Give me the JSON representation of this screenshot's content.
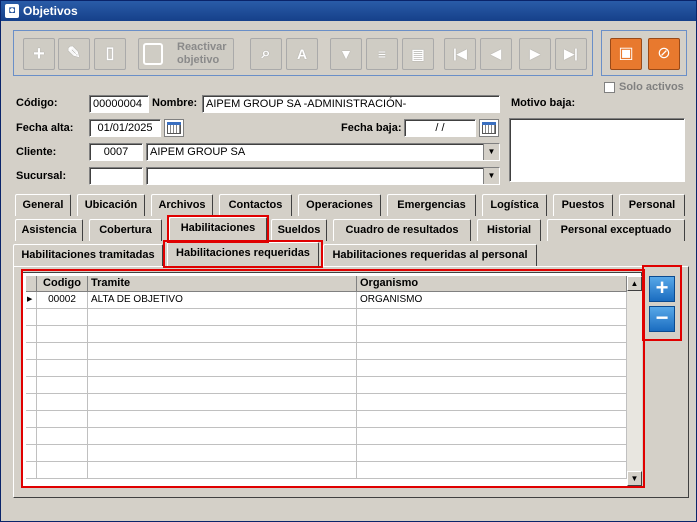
{
  "window": {
    "title": "Objetivos",
    "app_icon": "app-icon"
  },
  "toolbar": {
    "buttons": [
      {
        "name": "add-button",
        "icon": "plus-icon",
        "glyph": "+"
      },
      {
        "name": "edit-button",
        "icon": "pencil-icon",
        "glyph": "✎"
      },
      {
        "name": "delete-button",
        "icon": "delete-document-icon",
        "glyph": "▯"
      },
      {
        "name": "reactivar-objetivo-button",
        "icon": "reactivate-icon",
        "label": "Reactivar objetivo"
      },
      {
        "name": "search-button",
        "icon": "magnifier-icon",
        "glyph": "⌕"
      },
      {
        "name": "sort-button",
        "icon": "sort-az-icon",
        "glyph": "A"
      },
      {
        "name": "filter-button",
        "icon": "funnel-icon",
        "glyph": "▼"
      },
      {
        "name": "report-button",
        "icon": "clipboard-icon",
        "glyph": "≡"
      },
      {
        "name": "print-button",
        "icon": "printer-icon",
        "glyph": "▤"
      },
      {
        "name": "first-record-button",
        "icon": "first-icon",
        "glyph": "|◀"
      },
      {
        "name": "previous-record-button",
        "icon": "previous-icon",
        "glyph": "◀"
      },
      {
        "name": "next-record-button",
        "icon": "next-icon",
        "glyph": "▶"
      },
      {
        "name": "last-record-button",
        "icon": "last-icon",
        "glyph": "▶|"
      }
    ],
    "save_icon": "save-icon",
    "cancel_icon": "cancel-icon"
  },
  "solo_activos": {
    "label": "Solo activos",
    "checked": false
  },
  "form": {
    "codigo_label": "Código:",
    "codigo_value": "00000004",
    "nombre_label": "Nombre:",
    "nombre_value": "AIPEM GROUP SA -ADMINISTRACIÓN-",
    "motivo_baja_label": "Motivo baja:",
    "motivo_baja_value": "",
    "fecha_alta_label": "Fecha alta:",
    "fecha_alta_value": "01/01/2025",
    "fecha_baja_label": "Fecha baja:",
    "fecha_baja_value": "/ /",
    "cliente_label": "Cliente:",
    "cliente_code": "0007",
    "cliente_name": "AIPEM GROUP SA",
    "sucursal_label": "Sucursal:",
    "sucursal_code": "",
    "sucursal_name": ""
  },
  "tabs_row1": [
    "General",
    "Ubicación",
    "Archivos",
    "Contactos",
    "Operaciones",
    "Emergencias",
    "Logística",
    "Puestos",
    "Personal"
  ],
  "tabs_row2": [
    "Asistencia",
    "Cobertura",
    "Habilitaciones",
    "Sueldos",
    "Cuadro de resultados",
    "Historial",
    "Personal exceptuado"
  ],
  "active_tab": "Habilitaciones",
  "subtabs": [
    "Habilitaciones tramitadas",
    "Habilitaciones requeridas",
    "Habilitaciones requeridas al personal"
  ],
  "active_subtab": "Habilitaciones requeridas",
  "grid": {
    "columns": [
      "Codigo",
      "Tramite",
      "Organismo"
    ],
    "rows": [
      {
        "codigo": "00002",
        "tramite": "ALTA DE OBJETIVO",
        "organismo": "ORGANISMO"
      }
    ]
  },
  "side_buttons": [
    {
      "name": "add-row-button",
      "icon": "plus-icon",
      "glyph": "+"
    },
    {
      "name": "remove-row-button",
      "icon": "minus-icon",
      "glyph": "−"
    }
  ],
  "colors": {
    "highlight": "#e00000",
    "title_bar": "#1e4f9a",
    "accent_orange": "#e8792e",
    "accent_blue": "#2a80d8"
  }
}
